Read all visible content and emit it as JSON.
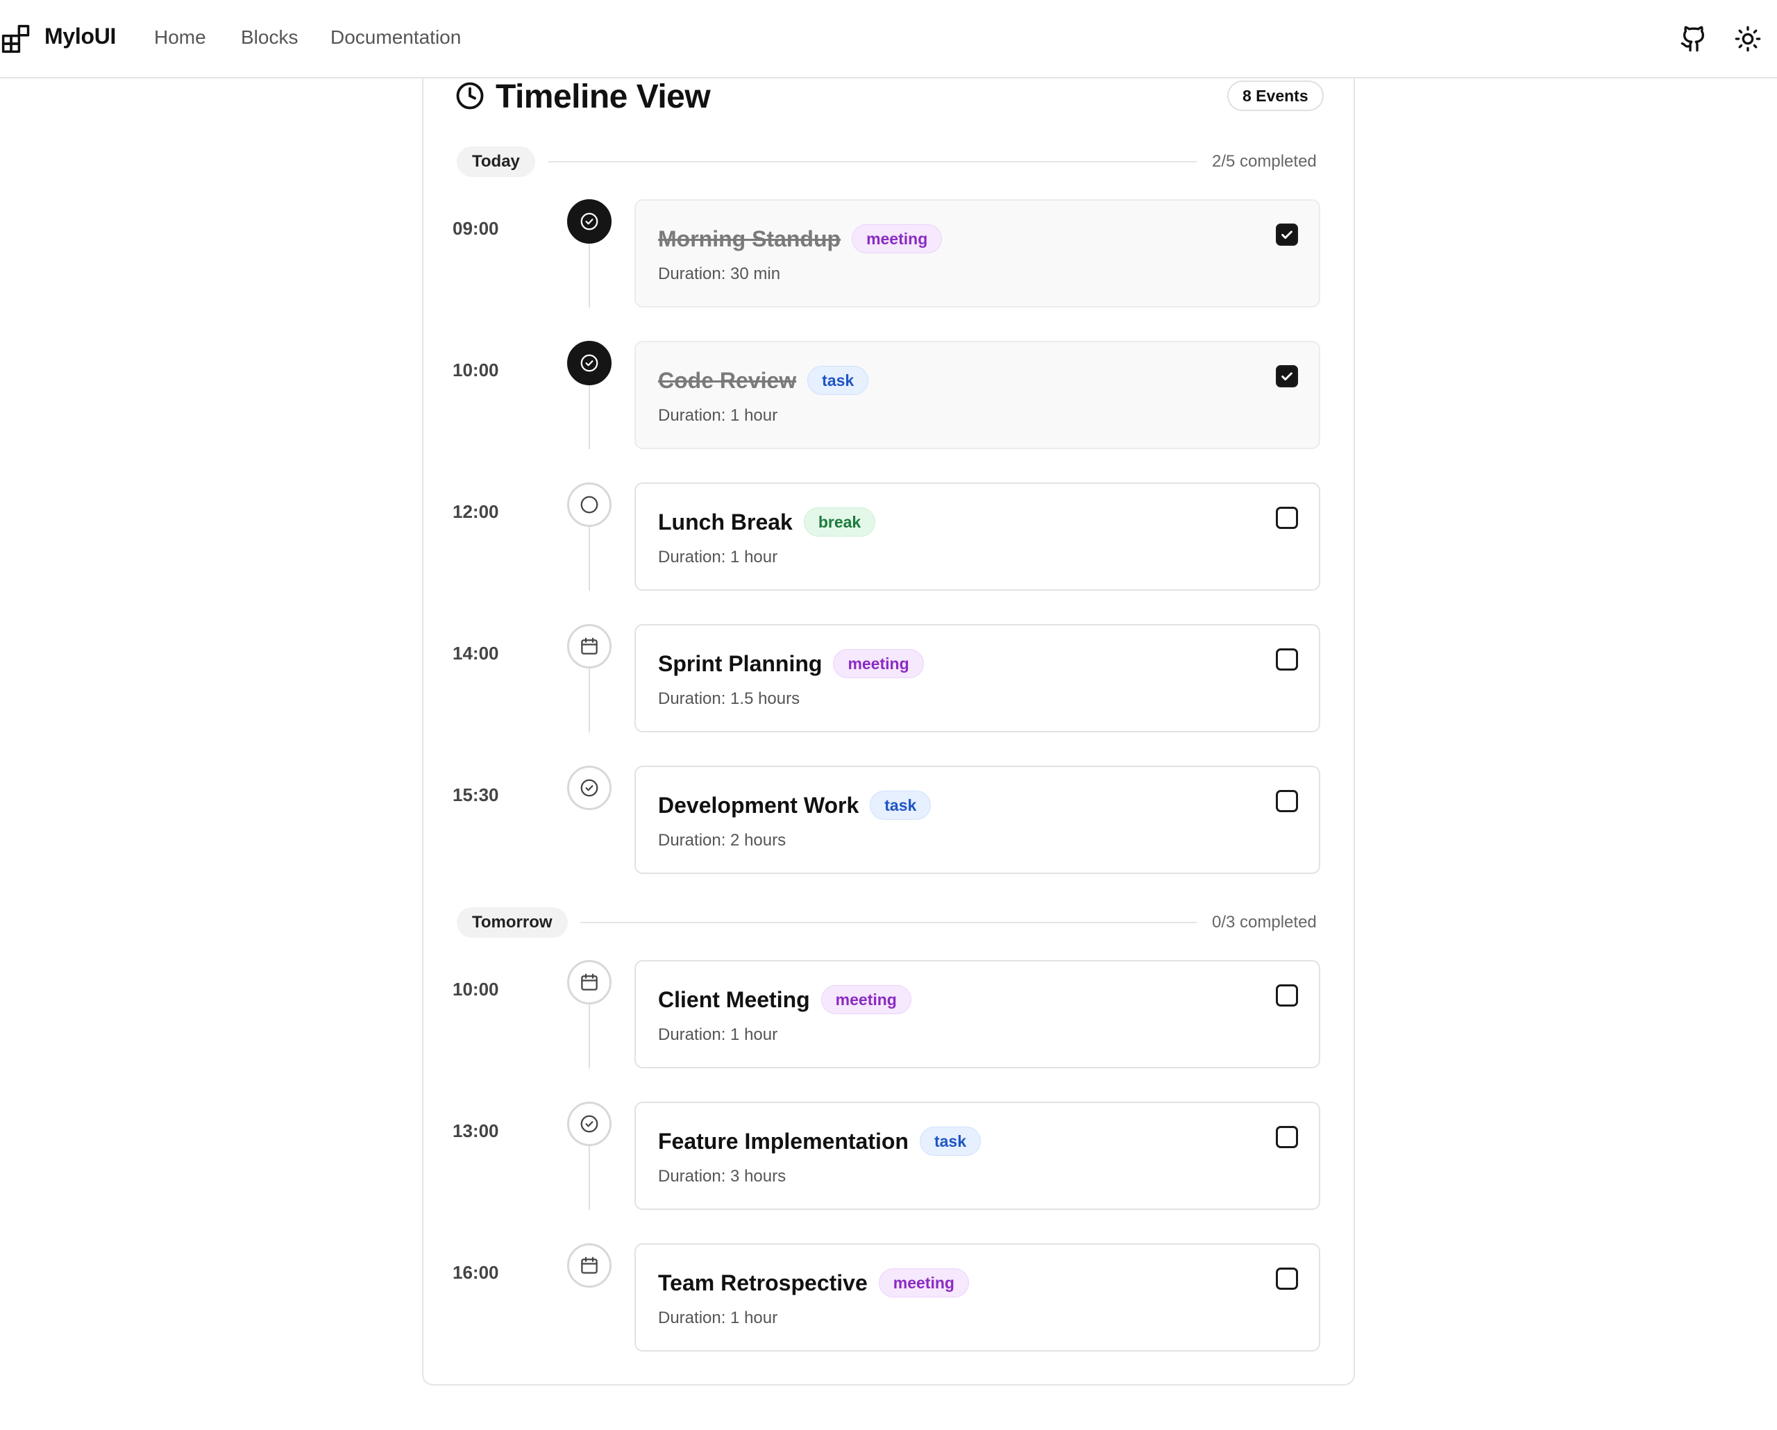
{
  "nav": {
    "brand": "MyloUI",
    "links": [
      "Home",
      "Blocks",
      "Documentation"
    ],
    "icons": [
      "layout-grid-icon",
      "github-icon",
      "sun-icon"
    ]
  },
  "timeline": {
    "title": "Timeline View",
    "events_badge": "8 Events",
    "groups": [
      {
        "label": "Today",
        "completed": "2/5 completed",
        "events": [
          {
            "time": "09:00",
            "title": "Morning Standup",
            "tag": "meeting",
            "duration": "Duration: 30 min",
            "done": true,
            "icon": "check-circle-icon"
          },
          {
            "time": "10:00",
            "title": "Code Review",
            "tag": "task",
            "duration": "Duration: 1 hour",
            "done": true,
            "icon": "check-circle-icon"
          },
          {
            "time": "12:00",
            "title": "Lunch Break",
            "tag": "break",
            "duration": "Duration: 1 hour",
            "done": false,
            "icon": "circle-icon"
          },
          {
            "time": "14:00",
            "title": "Sprint Planning",
            "tag": "meeting",
            "duration": "Duration: 1.5 hours",
            "done": false,
            "icon": "calendar-icon"
          },
          {
            "time": "15:30",
            "title": "Development Work",
            "tag": "task",
            "duration": "Duration: 2 hours",
            "done": false,
            "icon": "check-circle-icon"
          }
        ]
      },
      {
        "label": "Tomorrow",
        "completed": "0/3 completed",
        "events": [
          {
            "time": "10:00",
            "title": "Client Meeting",
            "tag": "meeting",
            "duration": "Duration: 1 hour",
            "done": false,
            "icon": "calendar-icon"
          },
          {
            "time": "13:00",
            "title": "Feature Implementation",
            "tag": "task",
            "duration": "Duration: 3 hours",
            "done": false,
            "icon": "check-circle-icon"
          },
          {
            "time": "16:00",
            "title": "Team Retrospective",
            "tag": "meeting",
            "duration": "Duration: 1 hour",
            "done": false,
            "icon": "calendar-icon"
          }
        ]
      }
    ]
  }
}
